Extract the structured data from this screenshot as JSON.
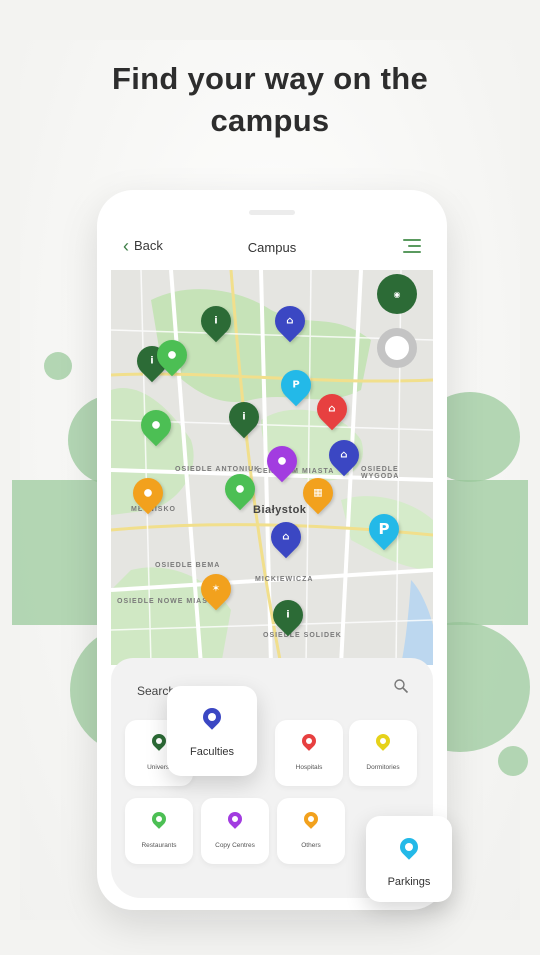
{
  "headline": {
    "line1": "Find your way on the",
    "line2": "campus"
  },
  "topbar": {
    "back_label": "Back",
    "title": "Campus"
  },
  "map": {
    "city": "Białystok",
    "districts": [
      "OSIEDLE ANTONIUK",
      "CENTRUM MIASTA",
      "OSIEDLE WYGODA",
      "MŁYNISKO",
      "OSIEDLE BEMA",
      "OSIEDLE NOWE MIASTO",
      "MICKIEWICZA",
      "OSIEDLE SOLIDEK"
    ],
    "pins": [
      {
        "label": "i",
        "color": "#2c6b36"
      },
      {
        "label": "⌂",
        "color": "#3b47c3"
      },
      {
        "label": "i",
        "color": "#2c6b36"
      },
      {
        "label": "●",
        "color": "#4cbf54"
      },
      {
        "label": "P",
        "color": "#23b9e8"
      },
      {
        "label": "⌂",
        "color": "#e74040"
      },
      {
        "label": "●",
        "color": "#4cbf54"
      },
      {
        "label": "i",
        "color": "#2c6b36"
      },
      {
        "label": "⌂",
        "color": "#3b47c3"
      },
      {
        "label": "●",
        "color": "#a23ce0"
      },
      {
        "label": "●",
        "color": "#f2a11d"
      },
      {
        "label": "●",
        "color": "#4cbf54"
      },
      {
        "label": "▦",
        "color": "#f2a11d"
      },
      {
        "label": "P",
        "color": "#23b9e8"
      },
      {
        "label": "⌂",
        "color": "#3b47c3"
      },
      {
        "label": "✶",
        "color": "#f2a11d"
      },
      {
        "label": "i",
        "color": "#2c6b36"
      }
    ]
  },
  "search": {
    "label": "Search"
  },
  "categories": {
    "universities": "Univers.",
    "faculties": "Faculties",
    "hospitals": "Hospitals",
    "dormitories": "Dormitories",
    "restaurants": "Restaurants",
    "copy_centres": "Copy Centres",
    "others": "Others",
    "parkings": "Parkings"
  },
  "colors": {
    "accent_green": "#2c6b36",
    "light_green": "#9ccb9e",
    "blue": "#3b47c3",
    "red": "#e74040",
    "yellow": "#e6d21a",
    "green": "#4cbf54",
    "purple": "#a23ce0",
    "orange": "#f2a11d",
    "cyan": "#23b9e8"
  }
}
